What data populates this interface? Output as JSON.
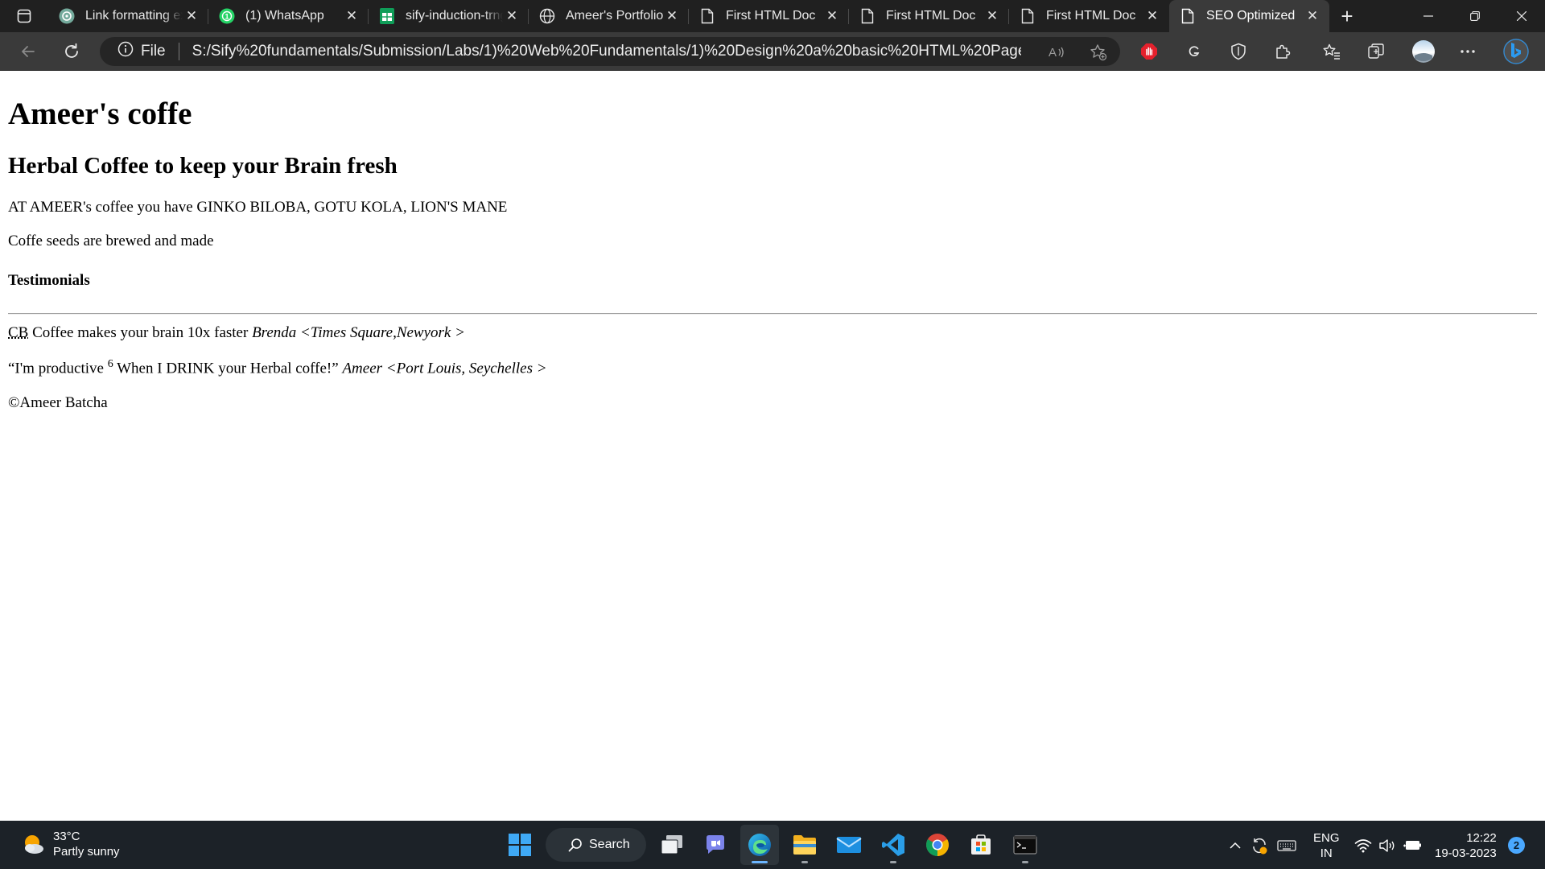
{
  "browser": {
    "tabs": [
      {
        "title": "Link formatting ex",
        "icon": "chatgpt-icon",
        "active": false
      },
      {
        "title": "(1) WhatsApp",
        "icon": "whatsapp-icon",
        "active": false
      },
      {
        "title": "sify-induction-trng",
        "icon": "google-sheets-icon",
        "active": false
      },
      {
        "title": "Ameer's Portfolio",
        "icon": "globe-icon",
        "active": false
      },
      {
        "title": "First HTML Doc",
        "icon": "file-icon",
        "active": false
      },
      {
        "title": "First HTML Doc",
        "icon": "file-icon",
        "active": false
      },
      {
        "title": "First HTML Doc",
        "icon": "file-icon",
        "active": false
      },
      {
        "title": "SEO Optimized",
        "icon": "file-icon",
        "active": true
      }
    ],
    "address_bar": {
      "scheme_label": "File",
      "url": "S:/Sify%20fundamentals/Submission/Labs/1)%20Web%20Fundamentals/1)%20Design%20a%20basic%20HTML%20Page/seo_optimized...."
    }
  },
  "page": {
    "h1": "Ameer's coffe",
    "h2": "Herbal Coffee to keep your Brain fresh",
    "ingredients": "AT AMEER's coffee you have GINKO BILOBA, GOTU KOLA, LION'S MANE",
    "seeds": "Coffe seeds are brewed and made",
    "testimonials_heading": "Testimonials",
    "quote1": {
      "abbr": "CB",
      "text": " Coffee makes your brain 10x faster ",
      "cite": "Brenda <Times Square,Newyork >"
    },
    "quote2": {
      "before": "“I'm productive ",
      "sup": "6",
      "after": " When I DRINK your Herbal coffe!” ",
      "cite": "Ameer <Port Louis, Seychelles >"
    },
    "footer": "©Ameer Batcha"
  },
  "taskbar": {
    "weather": {
      "temp": "33°C",
      "condition": "Partly sunny"
    },
    "search_label": "Search",
    "language": {
      "line1": "ENG",
      "line2": "IN"
    },
    "clock": {
      "time": "12:22",
      "date": "19-03-2023"
    },
    "notification_count": "2",
    "apps": [
      "start-icon",
      "task-view-icon",
      "teams-chat-icon",
      "edge-icon",
      "file-explorer-icon",
      "mail-icon",
      "vscode-icon",
      "chrome-icon",
      "microsoft-store-icon",
      "terminal-icon"
    ]
  },
  "colors": {
    "tabbar_bg": "#202020",
    "toolbar_bg": "#3a3a3a",
    "taskbar_bg": "#1c2228",
    "accent": "#4aa8ff"
  }
}
